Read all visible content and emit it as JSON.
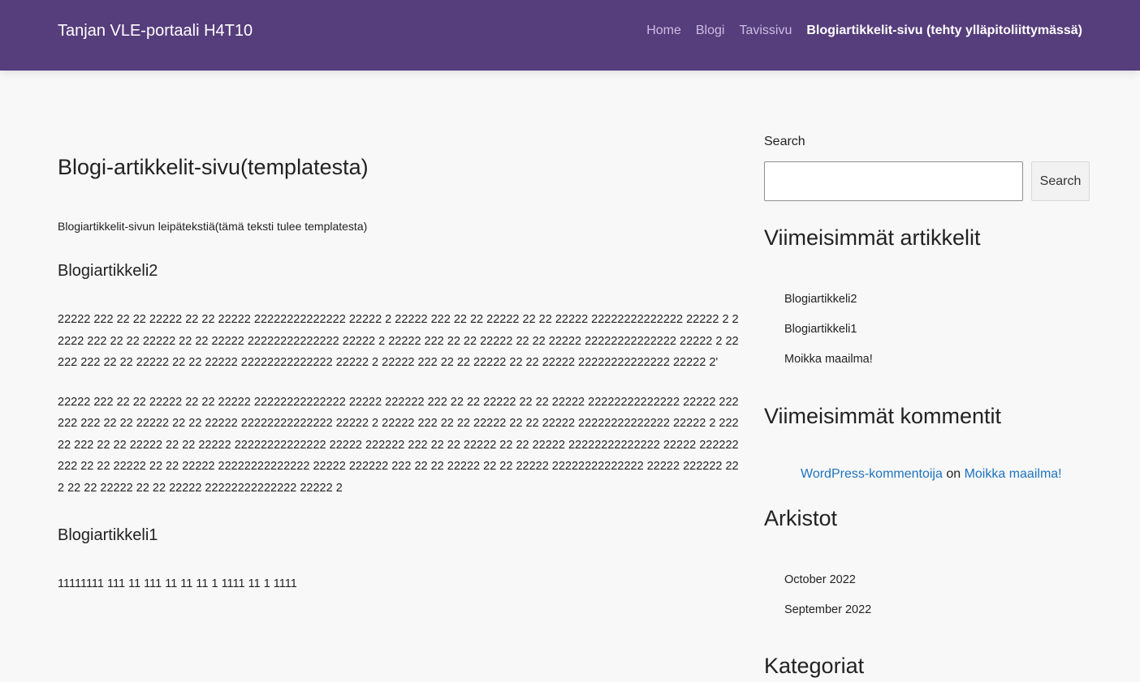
{
  "header": {
    "site_title": "Tanjan VLE-portaali H4T10",
    "nav": [
      {
        "label": "Home"
      },
      {
        "label": "Blogi"
      },
      {
        "label": "Tavissivu"
      },
      {
        "label": "Blogiartikkelit-sivu (tehty ylläpitoliittymässä)",
        "current": true
      }
    ],
    "colors": {
      "header_bg": "#563d7c",
      "link": "#1e73be"
    }
  },
  "main": {
    "title": "Blogi-artikkelit-sivu(templatesta)",
    "intro": "Blogiartikkelit-sivun leipätekstiä(tämä teksti tulee templatesta)",
    "posts": [
      {
        "title": "Blogiartikkeli2",
        "paragraphs": [
          "22222 222 22 22 22222 22 22 22222 22222222222222 22222 2 22222 222 22 22 22222 22 22 22222 22222222222222 22222 2 22222 222 22 22 22222 22 22 22222 22222222222222 22222 2 22222 222 22 22 22222 22 22 22222 22222222222222 22222 2 22222 222 22 22 22222 22 22 22222 22222222222222 22222 2 22222 222 22 22 22222 22 22 22222 22222222222222 22222 2'",
          "22222 222 22 22 22222 22 22 22222 22222222222222 22222 222222 222 22 22 22222 22 22 22222 22222222222222 22222 222222 222 22 22 22222 22 22 22222 22222222222222 22222 2 22222 222 22 22 22222 22 22 22222 22222222222222 22222 2 22222 222 22 22 22222 22 22 22222 22222222222222 22222 222222 222 22 22 22222 22 22 22222 22222222222222 22222 222222 222 22 22 22222 22 22 22222 22222222222222 22222 222222 222 22 22 22222 22 22 22222 22222222222222 22222 222222 222 22 22 22222 22 22 22222 22222222222222 22222 2"
        ]
      },
      {
        "title": "Blogiartikkeli1",
        "paragraphs": [
          "11111111 111 11 111 11 11 11 1 1111 11 1 1111"
        ]
      }
    ]
  },
  "sidebar": {
    "search": {
      "label": "Search",
      "placeholder": "",
      "button_label": "Search"
    },
    "recent_posts": {
      "title": "Viimeisimmät artikkelit",
      "items": [
        "Blogiartikkeli2",
        "Blogiartikkeli1",
        "Moikka maailma!"
      ]
    },
    "recent_comments": {
      "title": "Viimeisimmät kommentit",
      "author": "WordPress-kommentoija",
      "connector": "on",
      "post": "Moikka maailma!"
    },
    "archives": {
      "title": "Arkistot",
      "items": [
        "October 2022",
        "September 2022"
      ]
    },
    "categories": {
      "title": "Kategoriat"
    }
  }
}
